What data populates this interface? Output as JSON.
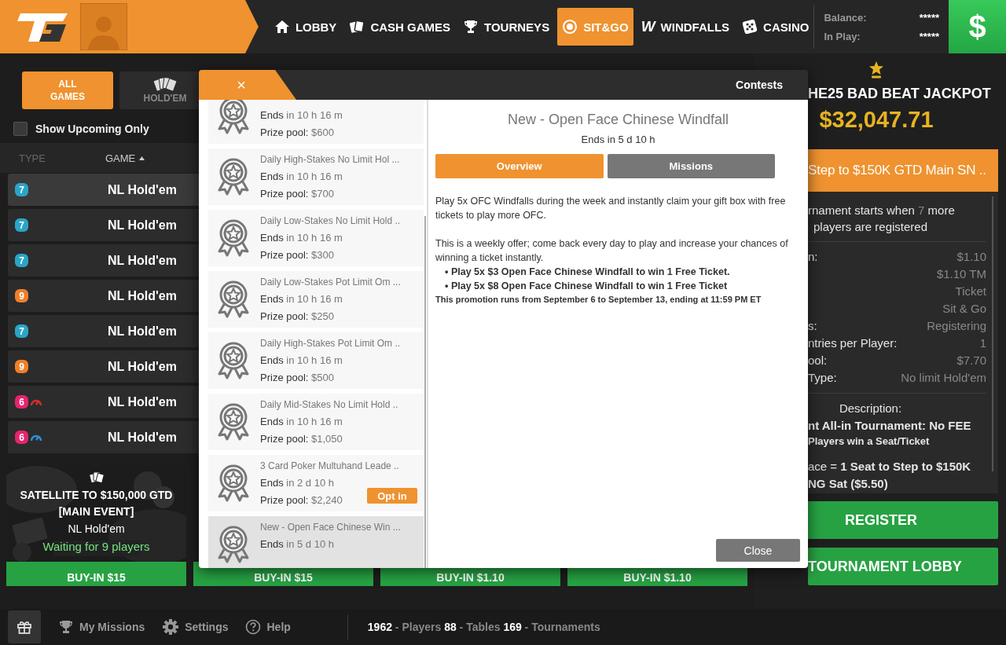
{
  "header": {
    "nav": [
      {
        "label": "LOBBY",
        "selected": false
      },
      {
        "label": "CASH GAMES",
        "selected": false
      },
      {
        "label": "TOURNEYS",
        "selected": false
      },
      {
        "label": "SIT&GO",
        "selected": true
      },
      {
        "label": "WINDFALLS",
        "selected": false,
        "glyph": "W"
      },
      {
        "label": "CASINO",
        "selected": false
      }
    ],
    "balance": [
      {
        "label": "Balance:",
        "value": "*****"
      },
      {
        "label": "In Play:",
        "value": "*****"
      }
    ],
    "cashier_symbol": "$"
  },
  "lobby": {
    "filters": [
      {
        "label": "ALL GAMES",
        "selected": true
      },
      {
        "label": "HOLD'EM",
        "selected": false
      }
    ],
    "show_upcoming": {
      "label": "Show Upcoming Only",
      "checked": false
    },
    "columns": [
      "TYPE",
      "GAME"
    ],
    "rows": [
      {
        "seats": "7",
        "color": "#2aa5c8",
        "game": "NL Hold'em",
        "selected": true
      },
      {
        "seats": "7",
        "color": "#2aa5c8",
        "game": "NL Hold'em",
        "selected": false
      },
      {
        "seats": "7",
        "color": "#2aa5c8",
        "game": "NL Hold'em",
        "selected": false
      },
      {
        "seats": "9",
        "color": "#ef7f2a",
        "game": "NL Hold'em",
        "selected": false
      },
      {
        "seats": "7",
        "color": "#2aa5c8",
        "game": "NL Hold'em",
        "selected": false
      },
      {
        "seats": "9",
        "color": "#ef7f2a",
        "game": "NL Hold'em",
        "selected": false
      },
      {
        "seats": "6",
        "color": "#e6246d",
        "gauge": {
          "color": "#d62d2d"
        },
        "game": "NL Hold'em",
        "selected": false
      },
      {
        "seats": "6",
        "color": "#e6246d",
        "gauge": {
          "color": "#2b8fd6"
        },
        "game": "NL Hold'em",
        "selected": false
      }
    ],
    "cards": [
      {
        "title_lines": [
          "SATELLITE TO $150,000 GTD",
          "[MAIN EVENT]"
        ],
        "game": "NL Hold'em",
        "status": "Waiting for 9 players",
        "buy_in": "BUY-IN $15"
      },
      {
        "buy_in": "BUY-IN $15"
      },
      {
        "buy_in": "BUY-IN $1.10"
      },
      {
        "buy_in": "BUY-IN $1.10"
      }
    ]
  },
  "side_panel": {
    "jackpot": {
      "title": "HE25 BAD BEAT JACKPOT",
      "amount": "$32,047.71"
    },
    "tournament": {
      "name": "Step to $150K GTD Main SN ..",
      "status_before": "rnament starts when ",
      "status_count": "7",
      "status_after": " more",
      "status_line2": "players are registered",
      "details": [
        {
          "label": "n:",
          "value": "$1.10"
        },
        {
          "value": "$1.10 TM"
        },
        {
          "value": "Ticket"
        },
        {
          "value": "Sit & Go"
        },
        {
          "label": "s:",
          "value": "Registering"
        },
        {
          "label": "ntries per Player:",
          "value": "1"
        },
        {
          "label": "ool:",
          "value": "$7.70"
        },
        {
          "label": "Type:",
          "value": "No limit Hold'em"
        }
      ],
      "description_heading": "Description:",
      "description": [
        {
          "kind": "lead",
          "text": "nt All-in Tournament: No FEE"
        },
        {
          "kind": "note",
          "text": "Players win a Seat/Ticket"
        },
        {
          "kind": "text",
          "text": "ace = **1 Seat to Step to $150K**"
        },
        {
          "kind": "lead",
          "text": "NG Sat ($5.50)"
        }
      ]
    },
    "buttons": [
      "REGISTER",
      "TOURNAMENT LOBBY"
    ]
  },
  "contests_dialog": {
    "close_symbol": "×",
    "title": "Contests",
    "contests": [
      {
        "ends_label": "Ends",
        "ends": "in 10 h 16 m",
        "prize_label": "Prize pool:",
        "prize": "$600",
        "selected": false
      },
      {
        "name": "Daily High-Stakes No Limit Hol ...",
        "ends_label": "Ends",
        "ends": "in 10 h 16 m",
        "prize_label": "Prize pool:",
        "prize": "$700",
        "selected": false
      },
      {
        "name": "Daily Low-Stakes No Limit Hold ..",
        "ends_label": "Ends",
        "ends": "in 10 h 16 m",
        "prize_label": "Prize pool:",
        "prize": "$300",
        "selected": false
      },
      {
        "name": "Daily Low-Stakes Pot Limit Om ...",
        "ends_label": "Ends",
        "ends": "in 10 h 16 m",
        "prize_label": "Prize pool:",
        "prize": "$250",
        "selected": false
      },
      {
        "name": "Daily High-Stakes Pot Limit Om ..",
        "ends_label": "Ends",
        "ends": "in 10 h 16 m",
        "prize_label": "Prize pool:",
        "prize": "$500",
        "selected": false
      },
      {
        "name": "Daily Mid-Stakes No Limit Hold ..",
        "ends_label": "Ends",
        "ends": "in 10 h 16 m",
        "prize_label": "Prize pool:",
        "prize": "$1,050",
        "selected": false
      },
      {
        "name": "3 Card Poker Multuhand Leade ..",
        "ends_label": "Ends",
        "ends": "in 2 d 10 h",
        "prize_label": "Prize pool:",
        "prize": "$2,240",
        "action": "Opt in",
        "selected": false
      },
      {
        "name": "New - Open Face Chinese Win ...",
        "ends_label": "Ends",
        "ends": "in 5 d 10 h",
        "selected": true
      }
    ],
    "detail": {
      "title": "New - Open Face Chinese Windfall",
      "ends": "Ends in 5 d 10 h",
      "tabs": [
        {
          "label": "Overview",
          "selected": true
        },
        {
          "label": "Missions",
          "selected": false
        }
      ],
      "paragraphs": [
        "Play 5x OFC Windfalls during the week and instantly claim your gift box with free tickets to play more OFC.",
        "This is a weekly offer; come back every day to play and increase your chances of winning a ticket instantly."
      ],
      "bullet": "•",
      "bullets": [
        "Play 5x $3 Open Face Chinese Windfall to win 1 Free Ticket.",
        "Play 5x $8 Open Face Chinese Windfall to win 1 Free Ticket"
      ],
      "fine_print": "This promotion runs from September 6 to September 13, ending at 11:59 PM ET"
    },
    "close_button": "Close"
  },
  "footer": {
    "links": [
      "My Missions",
      "Settings",
      "Help"
    ],
    "stats": "**1962** - Players **88** - Tables **169** - Tournaments"
  }
}
